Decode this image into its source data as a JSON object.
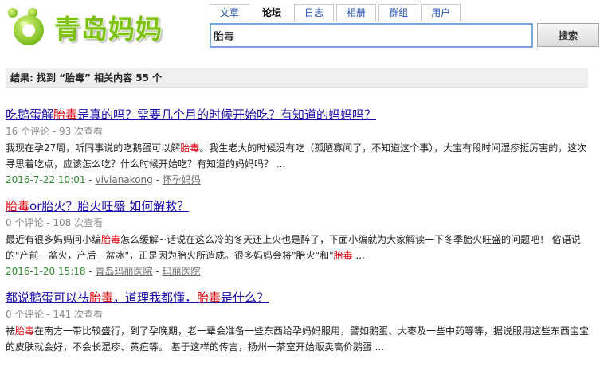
{
  "logo": {
    "text": "青岛妈妈"
  },
  "tabs": [
    {
      "label": "文章",
      "active": false
    },
    {
      "label": "论坛",
      "active": true
    },
    {
      "label": "日志",
      "active": false
    },
    {
      "label": "相册",
      "active": false
    },
    {
      "label": "群组",
      "active": false
    },
    {
      "label": "用户",
      "active": false
    }
  ],
  "search": {
    "value": "胎毒",
    "button_label": "搜索"
  },
  "result_summary": "结果: 找到 “胎毒” 相关内容 55 个",
  "highlight_color": "#e0000a",
  "results": [
    {
      "title_parts": [
        "吃鹅蛋解",
        "胎毒",
        "是真的吗？需要几个月的时候开始吃？有知道的妈妈吗？"
      ],
      "meta": "16 个评论 - 93 次查看",
      "snippet_parts": [
        "我现在孕27周，听同事说的吃鹅蛋可以解",
        "胎毒",
        "。我生老大的时候没有吃（孤陋寡闻了，不知道这个事），大宝有段时间湿疹挺厉害的，这次寻思着吃点，应该怎么吃？什么时候开始吃？有知道的妈妈吗？ ..."
      ],
      "date": "2016-7-22 10:01",
      "author": "vivianakong",
      "forum": "怀孕妈妈"
    },
    {
      "title_parts": [
        "胎毒",
        "or胎火？胎火旺盛 如何解救？"
      ],
      "meta": "0 个评论 - 108 次查看",
      "snippet_parts": [
        "最近有很多妈妈问小编",
        "胎毒",
        "怎么缓解~话说在这么冷的冬天还上火也是醉了，下面小编就为大家解读一下冬季胎火旺盛的问题吧！ 俗语说的\"产前一盆火，产后一盆冰\"，正是因为胎火所造成。很多妈妈会将\"胎火\"和\"",
        "胎毒",
        " ..."
      ],
      "date": "2016-1-20 15:18",
      "author": "青岛玛丽医院",
      "forum": "玛丽医院"
    },
    {
      "title_parts": [
        "都说鹅蛋可以祛",
        "胎毒",
        "，道理我都懂，",
        "胎毒",
        "是什么？"
      ],
      "meta": "0 个评论 - 141 次查看",
      "snippet_parts": [
        "祛",
        "胎毒",
        "在南方一带比较盛行，到了孕晚期，老一辈会准备一些东西给孕妈妈服用，譬如鹅蛋、大枣及一些中药等等，据说服用这些东西宝宝的皮肤就会好，不会长湿疹、黄疸等。 基于这样的传言，扬州一茶室开始贩卖高价鹅蛋 ..."
      ],
      "date": "",
      "author": "",
      "forum": ""
    }
  ]
}
